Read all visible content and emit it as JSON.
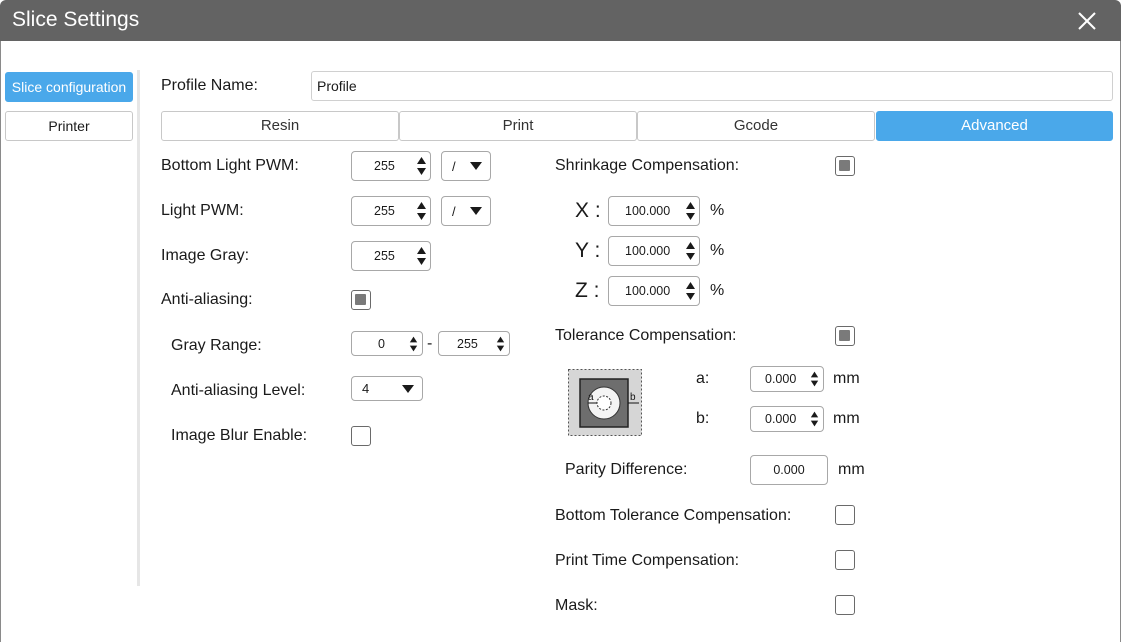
{
  "window": {
    "title": "Slice Settings"
  },
  "sidebar": {
    "items": [
      {
        "label": "Slice configuration",
        "active": true
      },
      {
        "label": "Printer",
        "active": false
      }
    ]
  },
  "profile": {
    "label": "Profile Name:",
    "value": "Profile"
  },
  "tabs": [
    {
      "label": "Resin",
      "active": false
    },
    {
      "label": "Print",
      "active": false
    },
    {
      "label": "Gcode",
      "active": false
    },
    {
      "label": "Advanced",
      "active": true
    }
  ],
  "left": {
    "bottom_light_pwm": {
      "label": "Bottom Light PWM:",
      "value": "255",
      "dropdown": "/"
    },
    "light_pwm": {
      "label": "Light PWM:",
      "value": "255",
      "dropdown": "/"
    },
    "image_gray": {
      "label": "Image Gray:",
      "value": "255"
    },
    "anti_aliasing": {
      "label": "Anti-aliasing:",
      "checked": true
    },
    "gray_range": {
      "label": "Gray Range:",
      "min": "0",
      "separator": "-",
      "max": "255"
    },
    "anti_aliasing_level": {
      "label": "Anti-aliasing Level:",
      "value": "4"
    },
    "image_blur": {
      "label": "Image Blur Enable:",
      "checked": false
    }
  },
  "right": {
    "shrinkage": {
      "label": "Shrinkage Compensation:",
      "checked": true,
      "x": {
        "axis": "X :",
        "value": "100.000",
        "unit": "%"
      },
      "y": {
        "axis": "Y :",
        "value": "100.000",
        "unit": "%"
      },
      "z": {
        "axis": "Z :",
        "value": "100.000",
        "unit": "%"
      }
    },
    "tolerance": {
      "label": "Tolerance Compensation:",
      "checked": true,
      "a": {
        "label": "a:",
        "value": "0.000",
        "unit": "mm"
      },
      "b": {
        "label": "b:",
        "value": "0.000",
        "unit": "mm"
      },
      "diagram_a": "a",
      "diagram_b": "b"
    },
    "parity": {
      "label": "Parity Difference:",
      "value": "0.000",
      "unit": "mm"
    },
    "bottom_tolerance": {
      "label": "Bottom Tolerance Compensation:",
      "checked": false
    },
    "print_time": {
      "label": "Print Time Compensation:",
      "checked": false
    },
    "mask": {
      "label": "Mask:",
      "checked": false
    }
  }
}
